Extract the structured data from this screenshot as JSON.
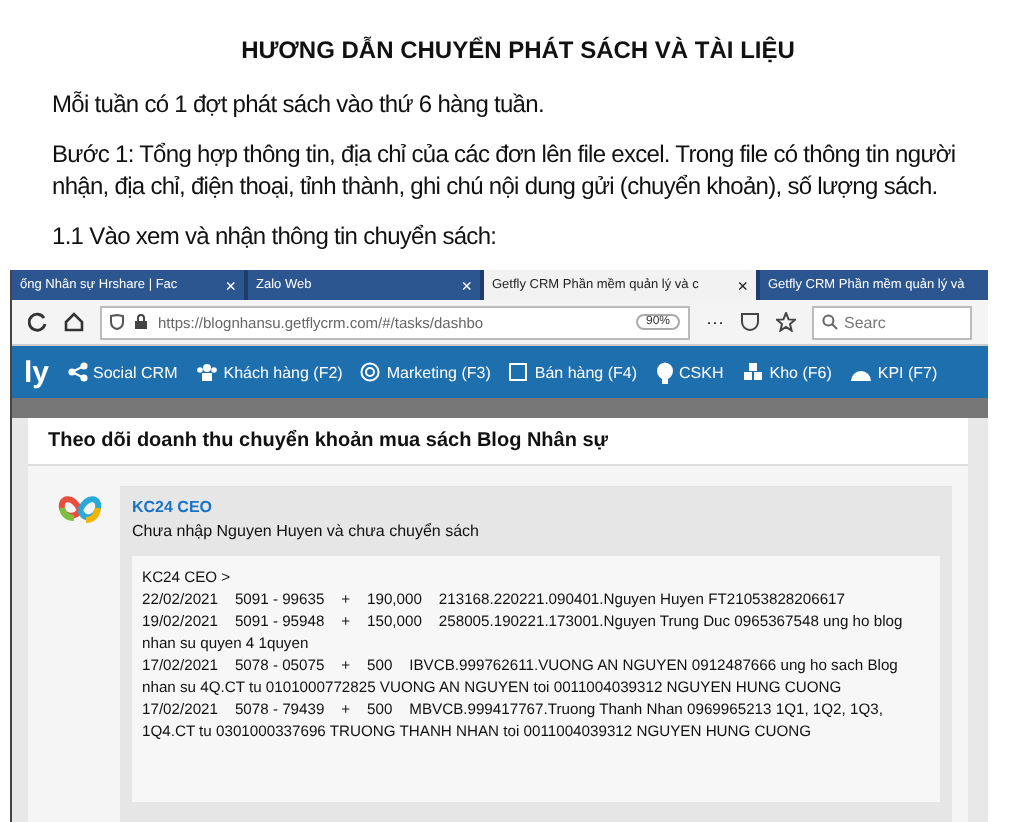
{
  "document": {
    "title": "HƯƠNG DẪN CHUYỂN PHÁT SÁCH VÀ TÀI LIỆU",
    "paragraphs": [
      "Mỗi tuần có 1 đợt phát sách vào thứ 6 hàng tuần.",
      "Bước 1: Tổng hợp thông tin, địa chỉ của các đơn lên file excel. Trong file có thông tin người nhận, địa chỉ, điện thoại, tỉnh thành, ghi chú nội dung gửi (chuyển khoản), số lượng sách.",
      "1.1 Vào xem và nhận thông tin chuyển sách:"
    ]
  },
  "browser": {
    "tabs": [
      {
        "label": "ống Nhân sự Hrshare | Fac",
        "close": "×",
        "selected": false
      },
      {
        "label": "Zalo Web",
        "close": "×",
        "selected": false
      },
      {
        "label": "Getfly CRM Phần mềm quản lý và c",
        "close": "×",
        "selected": true
      },
      {
        "label": "Getfly CRM Phần mềm quản lý và",
        "selected": false
      }
    ],
    "url": "https://blognhansu.getflycrm.com/#/tasks/dashbo",
    "zoom": "90%",
    "more": "···",
    "search_placeholder": "Searc"
  },
  "app": {
    "logo": "ly",
    "nav": [
      "Social CRM",
      "Khách hàng (F2)",
      "Marketing (F3)",
      "Bán hàng (F4)",
      "CSKH",
      "Kho (F6)",
      "KPI (F7)"
    ],
    "panel_title": "Theo dõi doanh thu chuyển khoản mua sách Blog Nhân sự",
    "comment": {
      "author": "KC24 CEO",
      "text": "Chưa nhập Nguyen Huyen và chưa chuyển sách",
      "quote_header": "KC24 CEO >",
      "entries": [
        "22/02/2021    5091 - 99635    +    190,000    213168.220221.090401.Nguyen Huyen FT21053828206617",
        "19/02/2021    5091 - 95948    +    150,000    258005.190221.173001.Nguyen Trung Duc 0965367548 ung ho blog nhan su quyen 4 1quyen",
        "17/02/2021    5078 - 05075    +    500    IBVCB.999762611.VUONG AN NGUYEN 0912487666 ung ho sach Blog nhan su 4Q.CT tu 0101000772825 VUONG AN NGUYEN toi 0011004039312 NGUYEN HUNG CUONG",
        "17/02/2021    5078 - 79439    +    500    MBVCB.999417767.Truong Thanh Nhan 0969965213 1Q1, 1Q2, 1Q3, 1Q4.CT tu 0301000337696 TRUONG THANH NHAN toi 0011004039312 NGUYEN HUNG CUONG"
      ]
    }
  }
}
